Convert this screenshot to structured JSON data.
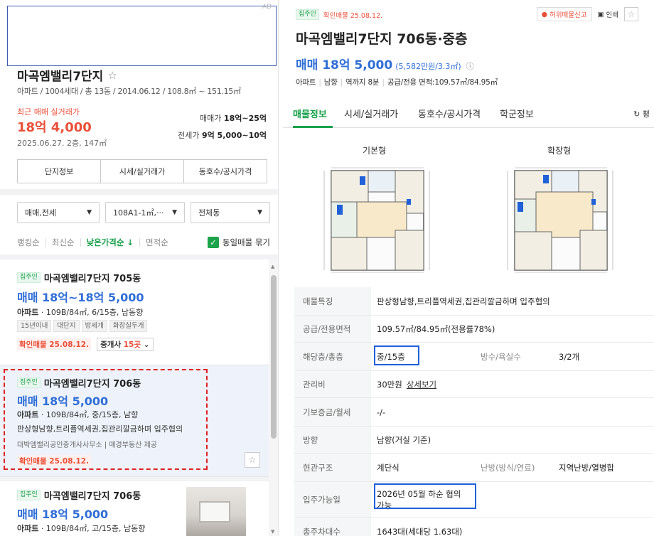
{
  "search": {
    "corner_text": "AD"
  },
  "complex": {
    "name": "마곡엠밸리7단지",
    "meta": "아파트 / 1004세대 / 총 13동 / 2014.06.12 / 108.8㎡ ~ 151.15㎡",
    "recent_label": "최근 매매 실거래가",
    "recent_price": "18억 4,000",
    "recent_date": "2025.06.27. 2층, 147㎡",
    "sale_range_label": "매매가",
    "sale_range": "18억~25억",
    "rent_range_label": "전세가",
    "rent_range": "9억 5,000~10억",
    "tabs": [
      "단지정보",
      "시세/실거래가",
      "동호수/공시가격"
    ]
  },
  "filters": [
    {
      "label": "매매,전세"
    },
    {
      "label": "108A1-1㎡,···"
    },
    {
      "label": "전체동"
    }
  ],
  "sort": {
    "items": [
      "랭킹순",
      "최신순",
      "낮은가격순 ↓",
      "면적순"
    ],
    "active_index": 2,
    "group_label": "동일매물 묶기",
    "group_checked": true
  },
  "listings": [
    {
      "badge": "집주인",
      "title": "마곡엠밸리7단지 705동",
      "price": "매매 18억~18억 5,000",
      "spec_type": "아파트",
      "spec": " · 109B/84㎡, 6/15층, 남동향",
      "tags": [
        "15년이내",
        "대단지",
        "방세개",
        "화장실두개"
      ],
      "verified": "확인매물 25.08.12.",
      "broker_label": "중개사",
      "broker_count": "15곳"
    },
    {
      "badge": "집주인",
      "title": "마곡엠밸리7단지 706동",
      "price": "매매 18억 5,000",
      "spec_type": "아파트",
      "spec": " · 109B/84㎡, 중/15층, 남향",
      "desc": "판상형남향,트리플역세권,집관리깔금하며 입주협의",
      "agent": "대박엠밸리공인중개사사무소 | 매경부동산 제공",
      "verified": "확인매물 25.08.12."
    },
    {
      "badge": "집주인",
      "title": "마곡엠밸리7단지 706동",
      "price": "매매 18억 5,000",
      "spec_type": "아파트",
      "spec": " · 109B/84㎡, 고/15층, 남동향"
    }
  ],
  "detail_header": {
    "badge": "집주인",
    "verified": "확인매물 25.08.12.",
    "report_label": "허위매물신고",
    "print_label": "인쇄",
    "title": "마곡엠밸리7단지 706동·중층",
    "price": "매매 18억 5,000",
    "price_per_unit": "(5,582만원/3.3㎡)",
    "meta": [
      "아파트",
      "남향",
      "역까지 8분",
      "공급/전용 면적:109.57㎡/84.95㎡"
    ]
  },
  "detail_tabs": {
    "items": [
      "매물정보",
      "시세/실거래가",
      "동호수/공시가격",
      "학군정보"
    ],
    "active_index": 0,
    "refresh_label": "평"
  },
  "floor_plans": [
    {
      "label": "기본형"
    },
    {
      "label": "확장형"
    }
  ],
  "detail_rows": [
    {
      "label": "매물특징",
      "value": "판상형남향,트리플역세권,집관리깔금하며 입주협의"
    },
    {
      "label": "공급/전용면적",
      "value": "109.57㎡/84.95㎡(전용률78%)"
    },
    {
      "label": "해당층/총층",
      "value": "중/15층",
      "label2": "방수/욕실수",
      "value2": "3/2개"
    },
    {
      "label": "관리비",
      "value": "30만원",
      "link": "상세보기"
    },
    {
      "label": "기보증금/월세",
      "value": "-/-"
    },
    {
      "label": "방향",
      "value": "남향(거실 기준)"
    },
    {
      "label": "현관구조",
      "value": "계단식",
      "label2": "난방(방식/연료)",
      "value2": "지역난방/열병합"
    },
    {
      "label": "입주가능일",
      "value_line1": "2026년 05월 하순 협의",
      "value_line2": "가능"
    },
    {
      "label": "총주차대수",
      "value": "1643대(세대당 1.63대)"
    }
  ],
  "colors": {
    "accent_green": "#18a04a",
    "price_blue": "#2f6ed6",
    "alert_red": "#e9503a",
    "highlight_blue_box": "#2060d8",
    "dashed_red": "#e02020"
  }
}
